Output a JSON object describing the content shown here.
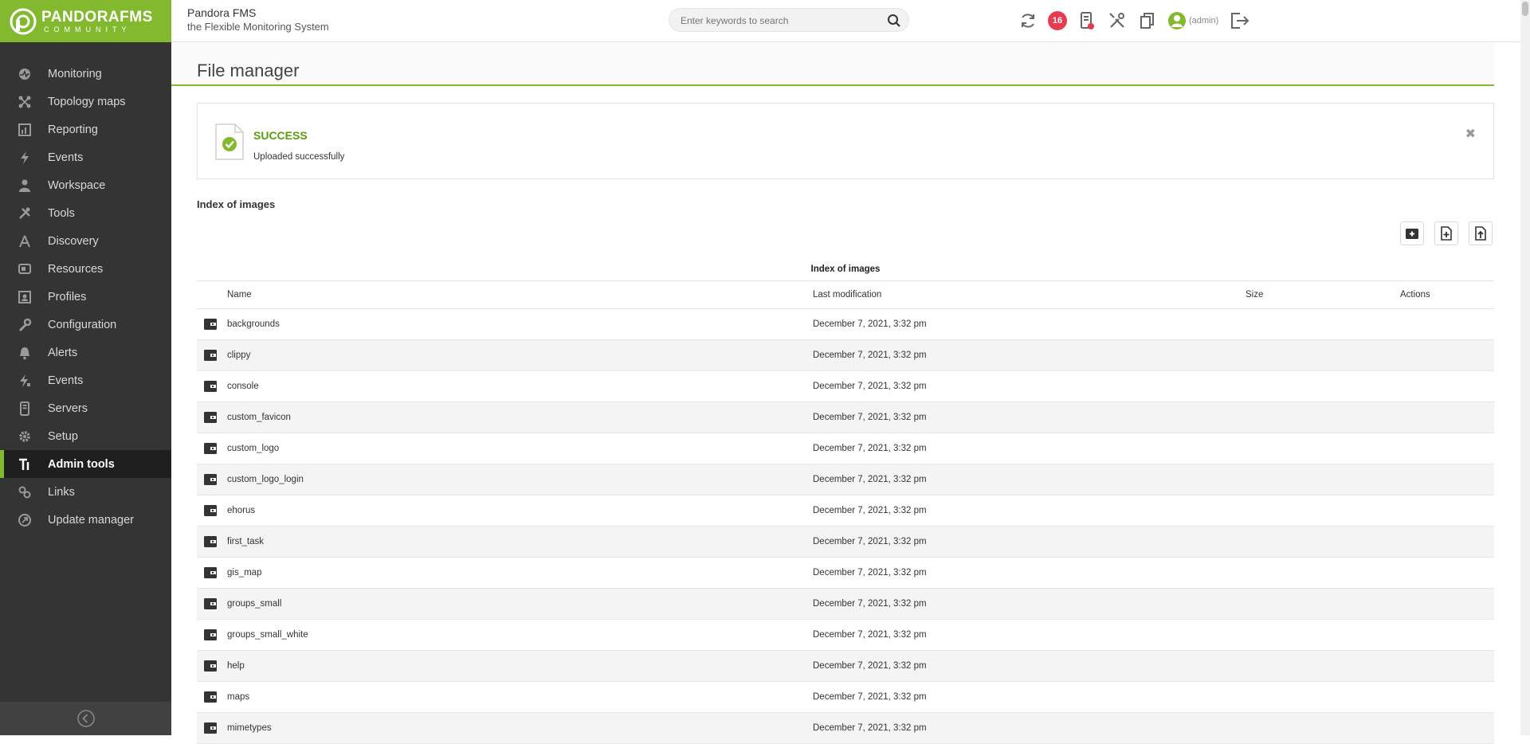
{
  "logo": {
    "main": "PANDORAFMS",
    "sub": "COMMUNITY"
  },
  "brand": {
    "title": "Pandora FMS",
    "subtitle": "the Flexible Monitoring System"
  },
  "search": {
    "placeholder": "Enter keywords to search"
  },
  "header": {
    "notifications_count": "16",
    "user": "(admin)"
  },
  "sidebar": {
    "items": [
      {
        "label": "Monitoring",
        "icon": "monitoring-icon"
      },
      {
        "label": "Topology maps",
        "icon": "topology-icon"
      },
      {
        "label": "Reporting",
        "icon": "reporting-icon"
      },
      {
        "label": "Events",
        "icon": "events-icon"
      },
      {
        "label": "Workspace",
        "icon": "workspace-icon"
      },
      {
        "label": "Tools",
        "icon": "tools-icon"
      },
      {
        "label": "Discovery",
        "icon": "discovery-icon"
      },
      {
        "label": "Resources",
        "icon": "resources-icon"
      },
      {
        "label": "Profiles",
        "icon": "profiles-icon"
      },
      {
        "label": "Configuration",
        "icon": "configuration-icon"
      },
      {
        "label": "Alerts",
        "icon": "alerts-icon"
      },
      {
        "label": "Events",
        "icon": "events-admin-icon"
      },
      {
        "label": "Servers",
        "icon": "servers-icon"
      },
      {
        "label": "Setup",
        "icon": "setup-icon"
      },
      {
        "label": "Admin tools",
        "icon": "admin-tools-icon",
        "active": true
      },
      {
        "label": "Links",
        "icon": "links-icon"
      },
      {
        "label": "Update manager",
        "icon": "update-manager-icon"
      }
    ]
  },
  "page": {
    "title": "File manager"
  },
  "alert": {
    "title": "SUCCESS",
    "message": "Uploaded successfully",
    "close": "✖"
  },
  "section": {
    "title": "Index of images"
  },
  "table": {
    "caption": "Index of images",
    "headers": {
      "name": "Name",
      "modified": "Last modification",
      "size": "Size",
      "actions": "Actions"
    },
    "rows": [
      {
        "name": "backgrounds",
        "modified": "December 7, 2021, 3:32 pm"
      },
      {
        "name": "clippy",
        "modified": "December 7, 2021, 3:32 pm"
      },
      {
        "name": "console",
        "modified": "December 7, 2021, 3:32 pm"
      },
      {
        "name": "custom_favicon",
        "modified": "December 7, 2021, 3:32 pm"
      },
      {
        "name": "custom_logo",
        "modified": "December 7, 2021, 3:32 pm"
      },
      {
        "name": "custom_logo_login",
        "modified": "December 7, 2021, 3:32 pm"
      },
      {
        "name": "ehorus",
        "modified": "December 7, 2021, 3:32 pm"
      },
      {
        "name": "first_task",
        "modified": "December 7, 2021, 3:32 pm"
      },
      {
        "name": "gis_map",
        "modified": "December 7, 2021, 3:32 pm"
      },
      {
        "name": "groups_small",
        "modified": "December 7, 2021, 3:32 pm"
      },
      {
        "name": "groups_small_white",
        "modified": "December 7, 2021, 3:32 pm"
      },
      {
        "name": "help",
        "modified": "December 7, 2021, 3:32 pm"
      },
      {
        "name": "maps",
        "modified": "December 7, 2021, 3:32 pm"
      },
      {
        "name": "mimetypes",
        "modified": "December 7, 2021, 3:32 pm"
      }
    ]
  },
  "colors": {
    "accent": "#82b92e",
    "sidebar": "#343434",
    "badge": "#e63c52",
    "success": "#5b9c0e"
  }
}
